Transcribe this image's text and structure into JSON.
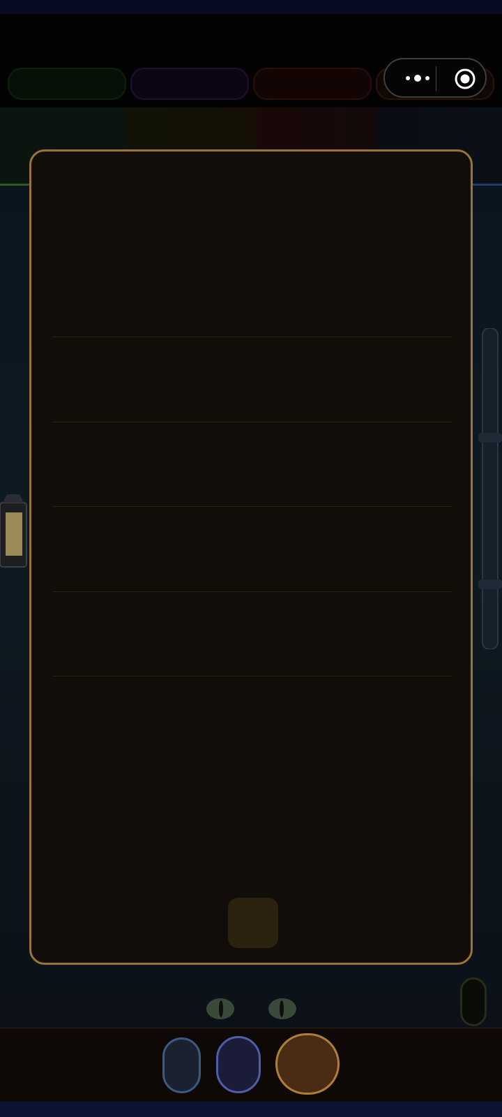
{
  "colors": {
    "panel_border": "#9a7436",
    "panel_background": "#120d09",
    "tab_green": "#071006",
    "tab_purple": "#0b0514",
    "tab_red": "#120504",
    "tab_orange": "#100804",
    "accent_orange": "#b07e36",
    "accent_blue": "#3a5a86"
  },
  "header": {
    "tabs": [
      {
        "id": "tab-1",
        "color": "green"
      },
      {
        "id": "tab-2",
        "color": "purple"
      },
      {
        "id": "tab-3",
        "color": "red"
      },
      {
        "id": "tab-4",
        "color": "orange"
      }
    ],
    "capsule": {
      "more_icon": "more-dots-icon",
      "close_icon": "target-circle-icon"
    }
  },
  "panel": {
    "rows": 5,
    "confirm_icon": "square-button"
  },
  "bottom_bar": {
    "buttons": [
      {
        "id": "left",
        "icon": "blue-pill"
      },
      {
        "id": "middle",
        "icon": "indigo-pill"
      },
      {
        "id": "main",
        "icon": "orange-circle"
      }
    ]
  }
}
